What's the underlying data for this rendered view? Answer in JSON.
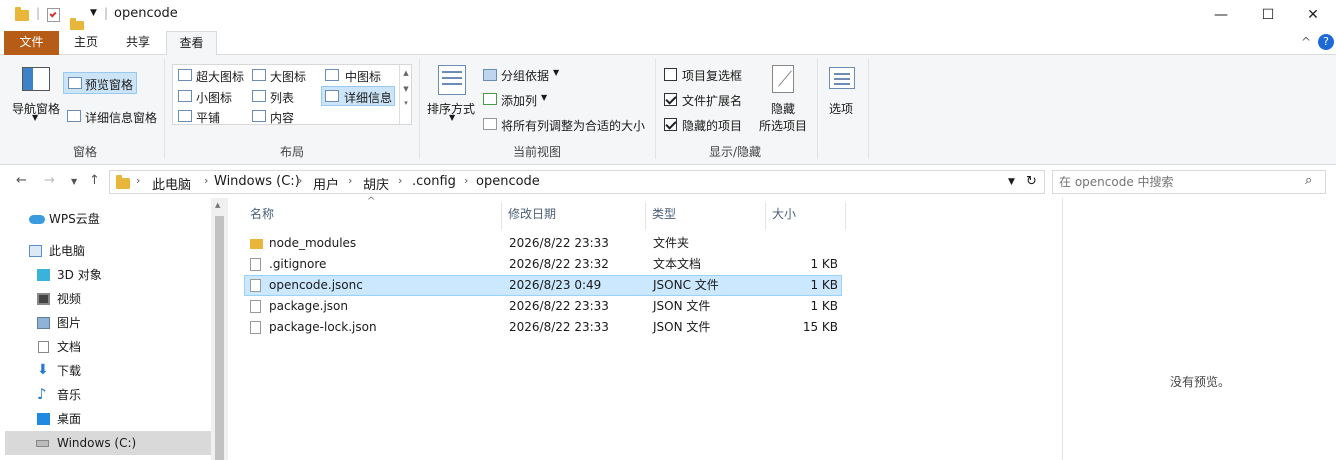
{
  "window": {
    "title": "opencode",
    "minimize": "—",
    "maximize": "☐",
    "close": "✕"
  },
  "tabs": {
    "file": "文件",
    "home": "主页",
    "share": "共享",
    "view": "查看",
    "collapse": "^",
    "help": "?"
  },
  "ribbon": {
    "panes": {
      "nav_pane": "导航窗格",
      "preview_pane": "预览窗格",
      "details_pane": "详细信息窗格",
      "label": "窗格"
    },
    "layout": {
      "extra_large": "超大图标",
      "large": "大图标",
      "medium": "中图标",
      "small": "小图标",
      "list": "列表",
      "details": "详细信息",
      "tiles": "平铺",
      "content": "内容",
      "label": "布局"
    },
    "current_view": {
      "sort_by": "排序方式",
      "group_by": "分组依据",
      "add_columns": "添加列",
      "size_all_columns": "将所有列调整为合适的大小",
      "label": "当前视图"
    },
    "show_hide": {
      "item_checkboxes": "项目复选框",
      "item_checkboxes_checked": false,
      "file_extensions": "文件扩展名",
      "file_extensions_checked": true,
      "hidden_items": "隐藏的项目",
      "hidden_items_checked": true,
      "hide_selected_1": "隐藏",
      "hide_selected_2": "所选项目",
      "label": "显示/隐藏"
    },
    "options": "选项"
  },
  "address": {
    "crumbs": [
      "此电脑",
      "Windows (C:)",
      "用户",
      "胡庆",
      ".config",
      "opencode"
    ],
    "search_placeholder": "在 opencode 中搜索"
  },
  "navpane": {
    "items": [
      {
        "label": "WPS云盘",
        "icon": "cloud-icon"
      },
      {
        "label": "此电脑",
        "icon": "computer-icon"
      },
      {
        "label": "3D 对象",
        "icon": "cube-icon"
      },
      {
        "label": "视频",
        "icon": "video-icon"
      },
      {
        "label": "图片",
        "icon": "picture-icon"
      },
      {
        "label": "文档",
        "icon": "document-icon"
      },
      {
        "label": "下载",
        "icon": "download-icon"
      },
      {
        "label": "音乐",
        "icon": "music-icon"
      },
      {
        "label": "桌面",
        "icon": "desktop-icon"
      },
      {
        "label": "Windows (C:)",
        "icon": "drive-icon"
      }
    ]
  },
  "filelist": {
    "columns": {
      "name": "名称",
      "modified": "修改日期",
      "type": "类型",
      "size": "大小"
    },
    "rows": [
      {
        "name": "node_modules",
        "modified": "2026/8/22 23:33",
        "type": "文件夹",
        "size": ""
      },
      {
        "name": ".gitignore",
        "modified": "2026/8/22 23:32",
        "type": "文本文档",
        "size": "1 KB"
      },
      {
        "name": "opencode.jsonc",
        "modified": "2026/8/23 0:49",
        "type": "JSONC 文件",
        "size": "1 KB"
      },
      {
        "name": "package.json",
        "modified": "2026/8/22 23:33",
        "type": "JSON 文件",
        "size": "1 KB"
      },
      {
        "name": "package-lock.json",
        "modified": "2026/8/22 23:33",
        "type": "JSON 文件",
        "size": "15 KB"
      }
    ]
  },
  "preview": {
    "text": "没有预览。"
  },
  "colors": {
    "file_tab": "#b75c16",
    "selection": "#cce8ff",
    "folder": "#e8b73a",
    "ribbon_bg": "#f5f6f7"
  }
}
